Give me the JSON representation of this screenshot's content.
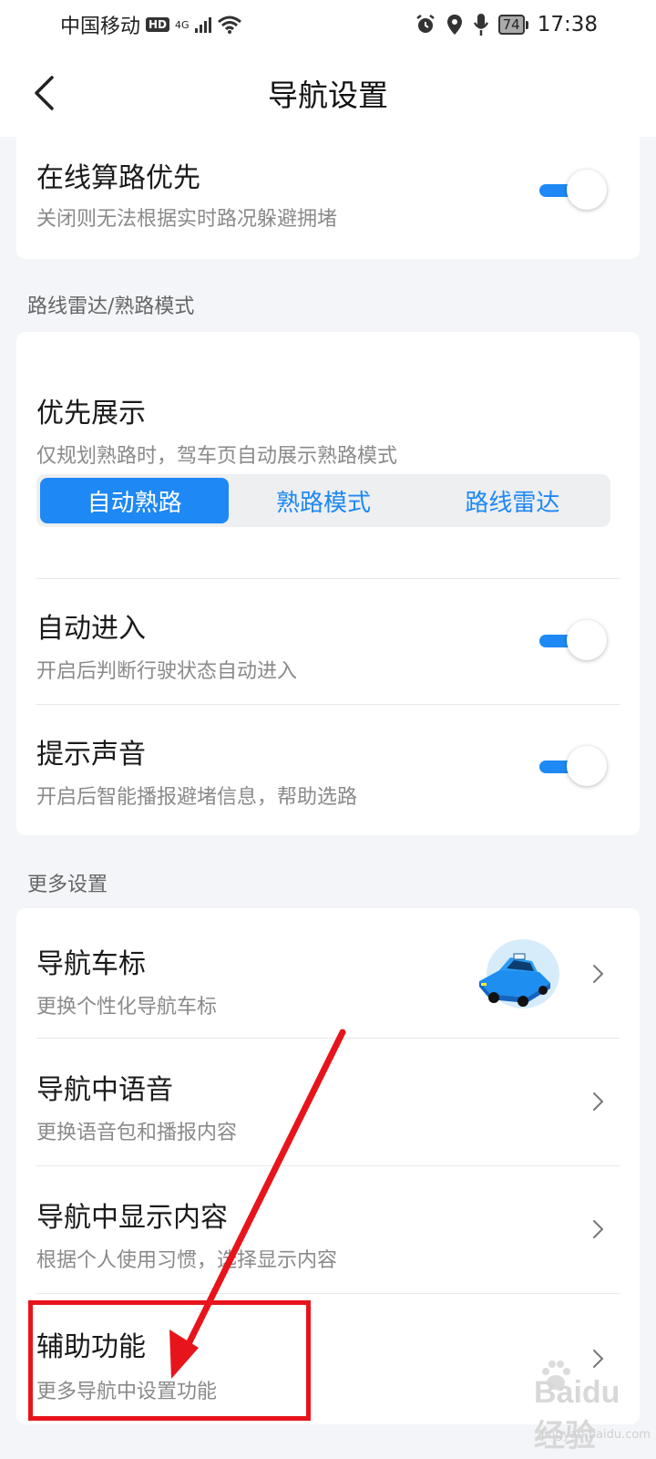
{
  "status_bar": {
    "carrier": "中国移动",
    "hd": "HD",
    "network": "4G",
    "battery": "74",
    "time": "17:38"
  },
  "header": {
    "title": "导航设置"
  },
  "online_routing": {
    "title": "在线算路优先",
    "subtitle": "关闭则无法根据实时路况躲避拥堵",
    "enabled": true
  },
  "radar_section": {
    "label": "路线雷达/熟路模式",
    "priority": {
      "title": "优先展示",
      "subtitle": "仅规划熟路时，驾车页自动展示熟路模式",
      "options": [
        "自动熟路",
        "熟路模式",
        "路线雷达"
      ],
      "selected": "自动熟路"
    },
    "auto_enter": {
      "title": "自动进入",
      "subtitle": "开启后判断行驶状态自动进入",
      "enabled": true
    },
    "sound": {
      "title": "提示声音",
      "subtitle": "开启后智能播报避堵信息，帮助选路",
      "enabled": true
    }
  },
  "more_section": {
    "label": "更多设置",
    "items": [
      {
        "title": "导航车标",
        "subtitle": "更换个性化导航车标"
      },
      {
        "title": "导航中语音",
        "subtitle": "更换语音包和播报内容"
      },
      {
        "title": "导航中显示内容",
        "subtitle": "根据个人使用习惯，选择显示内容"
      },
      {
        "title": "辅助功能",
        "subtitle": "更多导航中设置功能"
      }
    ]
  },
  "colors": {
    "accent": "#1e88f5",
    "annotation": "#e8141c"
  },
  "watermark": {
    "brand": "Baidu经验",
    "url": "jingyan.baidu.com"
  }
}
